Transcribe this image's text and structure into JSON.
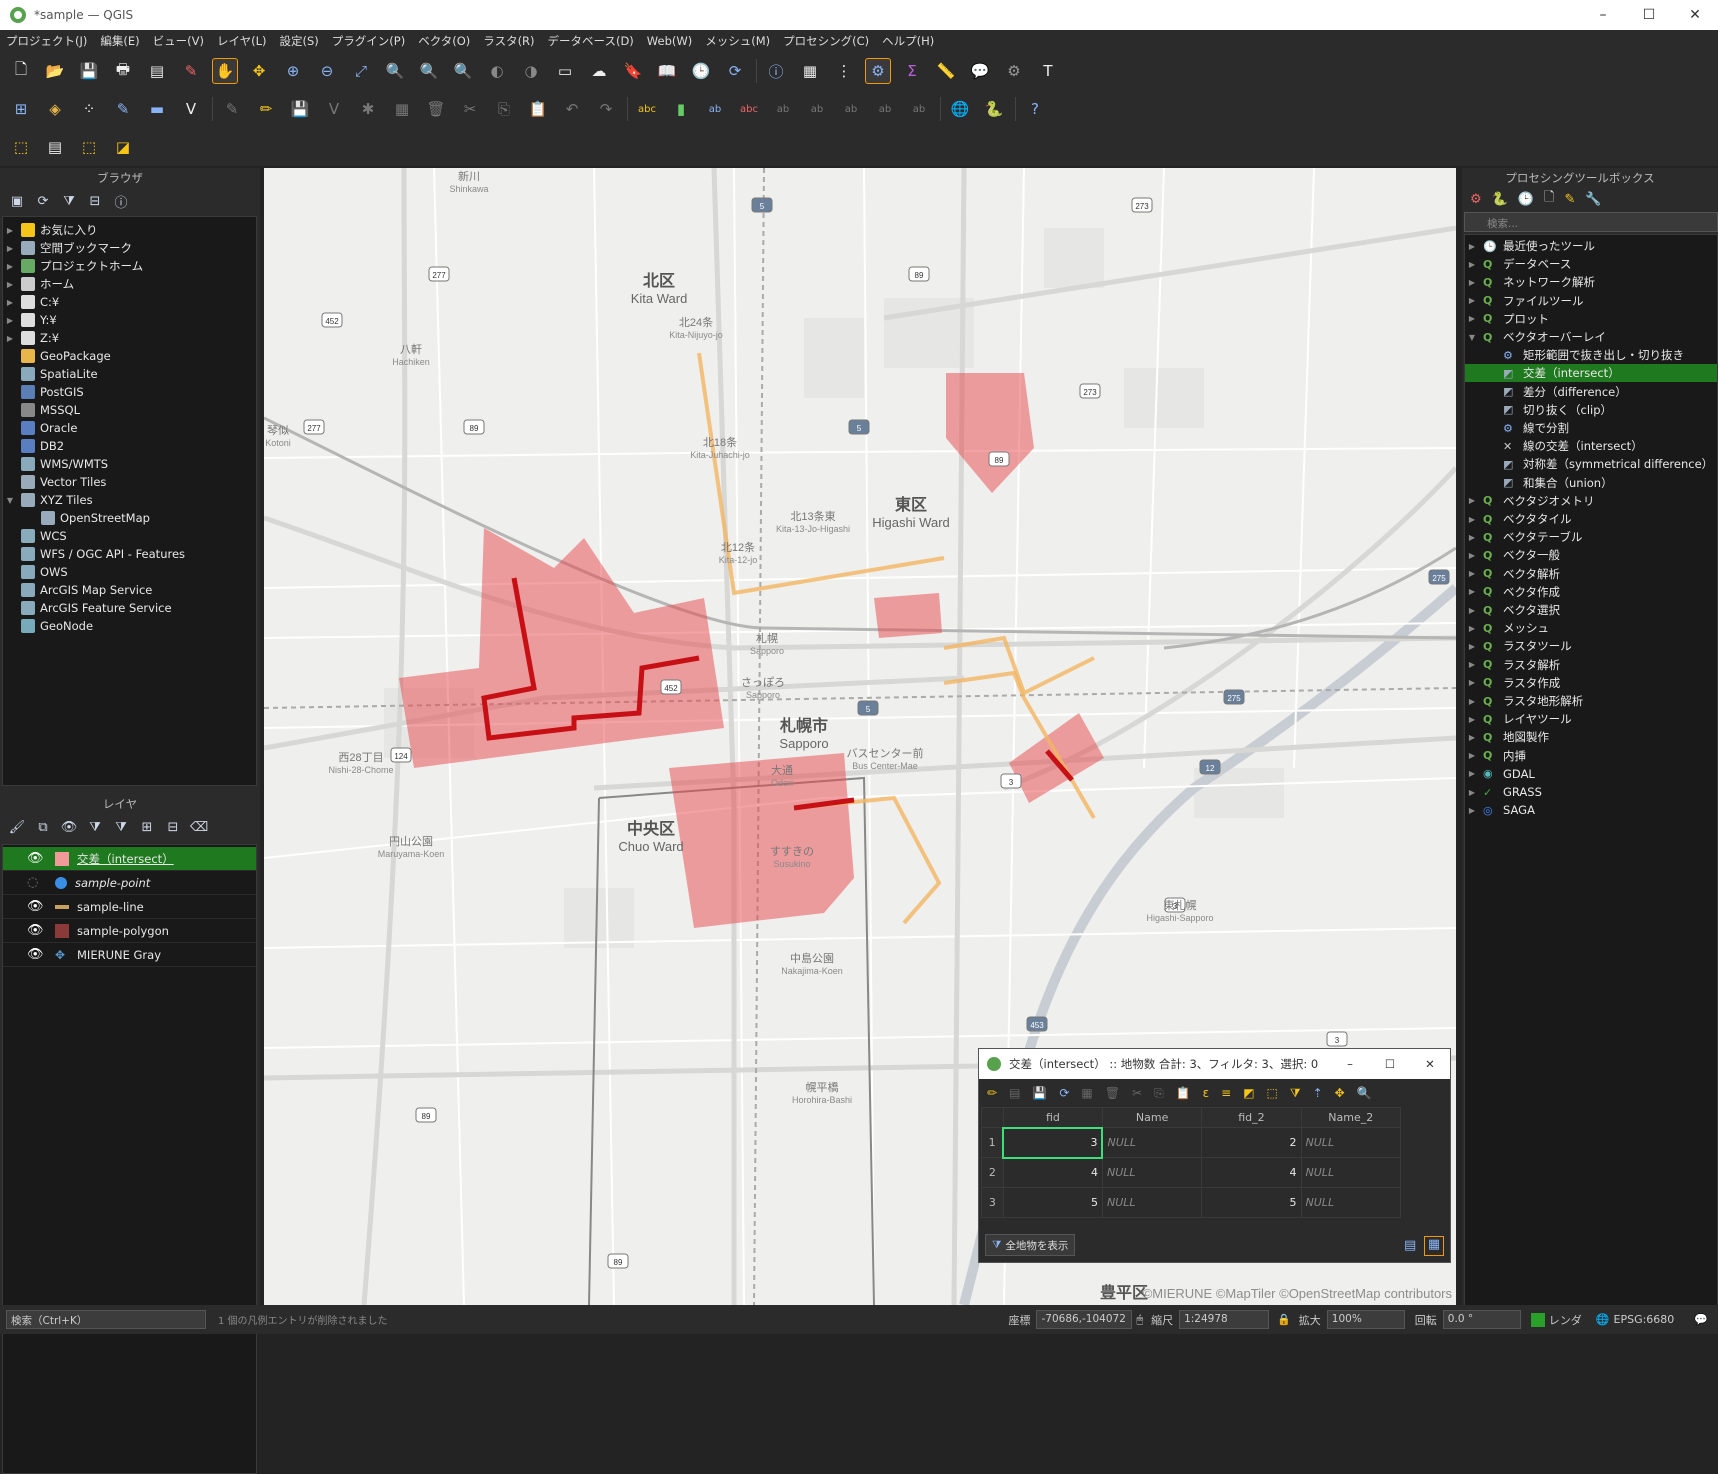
{
  "window": {
    "title": "*sample — QGIS",
    "minimize": "–",
    "maximize": "☐",
    "close": "✕"
  },
  "menu": [
    "プロジェクト(J)",
    "編集(E)",
    "ビュー(V)",
    "レイヤ(L)",
    "設定(S)",
    "プラグイン(P)",
    "ベクタ(O)",
    "ラスタ(R)",
    "データベース(D)",
    "Web(W)",
    "メッシュ(M)",
    "プロセシング(C)",
    "ヘルプ(H)"
  ],
  "browser": {
    "title": "ブラウザ",
    "items": [
      {
        "label": "お気に入り",
        "icon": "star-icon",
        "color": "#f5c518",
        "expandable": true
      },
      {
        "label": "空間ブックマーク",
        "icon": "bookmark-icon",
        "color": "#9ab",
        "expandable": true
      },
      {
        "label": "プロジェクトホーム",
        "icon": "project-home-icon",
        "color": "#6a6",
        "expandable": true
      },
      {
        "label": "ホーム",
        "icon": "home-icon",
        "color": "#ccc",
        "expandable": true
      },
      {
        "label": "C:¥",
        "icon": "folder-icon",
        "color": "#ddd",
        "expandable": true
      },
      {
        "label": "Y:¥",
        "icon": "folder-icon",
        "color": "#ddd",
        "expandable": true
      },
      {
        "label": "Z:¥",
        "icon": "folder-icon",
        "color": "#ddd",
        "expandable": true
      },
      {
        "label": "GeoPackage",
        "icon": "geopackage-icon",
        "color": "#e8b64a",
        "expandable": false
      },
      {
        "label": "SpatiaLite",
        "icon": "spatialite-icon",
        "color": "#8ab",
        "expandable": false
      },
      {
        "label": "PostGIS",
        "icon": "postgis-icon",
        "color": "#5b7fb5",
        "expandable": false
      },
      {
        "label": "MSSQL",
        "icon": "mssql-icon",
        "color": "#888",
        "expandable": false
      },
      {
        "label": "Oracle",
        "icon": "oracle-icon",
        "color": "#5a7fc0",
        "expandable": false
      },
      {
        "label": "DB2",
        "icon": "db2-icon",
        "color": "#5a7fc0",
        "expandable": false
      },
      {
        "label": "WMS/WMTS",
        "icon": "globe-icon",
        "color": "#8ab",
        "expandable": false
      },
      {
        "label": "Vector Tiles",
        "icon": "grid-icon",
        "color": "#9ab",
        "expandable": false
      },
      {
        "label": "XYZ Tiles",
        "icon": "grid-icon",
        "color": "#9ab",
        "expandable": true,
        "expanded": true
      },
      {
        "label": "OpenStreetMap",
        "icon": "grid-icon",
        "color": "#9ab",
        "expandable": false,
        "indent": true
      },
      {
        "label": "WCS",
        "icon": "globe-icon",
        "color": "#8ab",
        "expandable": false
      },
      {
        "label": "WFS / OGC API - Features",
        "icon": "globe-icon",
        "color": "#8ab",
        "expandable": false
      },
      {
        "label": "OWS",
        "icon": "globe-icon",
        "color": "#8ab",
        "expandable": false
      },
      {
        "label": "ArcGIS Map Service",
        "icon": "globe-icon",
        "color": "#8ab",
        "expandable": false
      },
      {
        "label": "ArcGIS Feature Service",
        "icon": "globe-icon",
        "color": "#8ab",
        "expandable": false
      },
      {
        "label": "GeoNode",
        "icon": "geonode-icon",
        "color": "#7ab",
        "expandable": false
      }
    ]
  },
  "layers": {
    "title": "レイヤ",
    "items": [
      {
        "label": "交差（intersect）",
        "visible": true,
        "selected": true,
        "italic": false,
        "symbol": "polygon",
        "color": "#f29999"
      },
      {
        "label": "sample-point",
        "visible": false,
        "selected": false,
        "italic": true,
        "symbol": "point",
        "color": "#3a8ee6"
      },
      {
        "label": "sample-line",
        "visible": true,
        "selected": false,
        "italic": false,
        "symbol": "line",
        "color": "#c8a060"
      },
      {
        "label": "sample-polygon",
        "visible": true,
        "selected": false,
        "italic": false,
        "symbol": "polygon",
        "color": "#8b3a3a"
      },
      {
        "label": "MIERUNE Gray",
        "visible": true,
        "selected": false,
        "italic": false,
        "symbol": "tiles",
        "color": "#5b9bd5"
      }
    ]
  },
  "processing": {
    "title": "プロセシングツールボックス",
    "search_placeholder": "検索...",
    "items": [
      {
        "label": "最近使ったツール",
        "level": 0,
        "icon": "clock-icon"
      },
      {
        "label": "データベース",
        "level": 0,
        "icon": "qgis-icon"
      },
      {
        "label": "ネットワーク解析",
        "level": 0,
        "icon": "qgis-icon"
      },
      {
        "label": "ファイルツール",
        "level": 0,
        "icon": "qgis-icon"
      },
      {
        "label": "プロット",
        "level": 0,
        "icon": "qgis-icon"
      },
      {
        "label": "ベクタオーバーレイ",
        "level": 0,
        "icon": "qgis-icon",
        "expanded": true
      },
      {
        "label": "矩形範囲で抜き出し・切り抜き",
        "level": 1,
        "icon": "gear-icon"
      },
      {
        "label": "交差（intersect）",
        "level": 1,
        "icon": "overlay-icon",
        "selected": true
      },
      {
        "label": "差分（difference）",
        "level": 1,
        "icon": "overlay-icon"
      },
      {
        "label": "切り抜く（clip）",
        "level": 1,
        "icon": "overlay-icon"
      },
      {
        "label": "線で分割",
        "level": 1,
        "icon": "gear-icon"
      },
      {
        "label": "線の交差（intersect）",
        "level": 1,
        "icon": "line-intersect-icon"
      },
      {
        "label": "対称差（symmetrical difference）",
        "level": 1,
        "icon": "overlay-icon"
      },
      {
        "label": "和集合（union）",
        "level": 1,
        "icon": "overlay-icon"
      },
      {
        "label": "ベクタジオメトリ",
        "level": 0,
        "icon": "qgis-icon"
      },
      {
        "label": "ベクタタイル",
        "level": 0,
        "icon": "qgis-icon"
      },
      {
        "label": "ベクタテーブル",
        "level": 0,
        "icon": "qgis-icon"
      },
      {
        "label": "ベクタ一般",
        "level": 0,
        "icon": "qgis-icon"
      },
      {
        "label": "ベクタ解析",
        "level": 0,
        "icon": "qgis-icon"
      },
      {
        "label": "ベクタ作成",
        "level": 0,
        "icon": "qgis-icon"
      },
      {
        "label": "ベクタ選択",
        "level": 0,
        "icon": "qgis-icon"
      },
      {
        "label": "メッシュ",
        "level": 0,
        "icon": "qgis-icon"
      },
      {
        "label": "ラスタツール",
        "level": 0,
        "icon": "qgis-icon"
      },
      {
        "label": "ラスタ解析",
        "level": 0,
        "icon": "qgis-icon"
      },
      {
        "label": "ラスタ作成",
        "level": 0,
        "icon": "qgis-icon"
      },
      {
        "label": "ラスタ地形解析",
        "level": 0,
        "icon": "qgis-icon"
      },
      {
        "label": "レイヤツール",
        "level": 0,
        "icon": "qgis-icon"
      },
      {
        "label": "地図製作",
        "level": 0,
        "icon": "qgis-icon"
      },
      {
        "label": "内挿",
        "level": 0,
        "icon": "qgis-icon"
      },
      {
        "label": "GDAL",
        "level": 0,
        "icon": "gdal-icon"
      },
      {
        "label": "GRASS",
        "level": 0,
        "icon": "grass-icon"
      },
      {
        "label": "SAGA",
        "level": 0,
        "icon": "saga-icon"
      }
    ]
  },
  "map": {
    "attribution": "©MIERUNE ©MapTiler ©OpenStreetMap contributors",
    "labels": [
      {
        "text": "北区",
        "sub": "Kita Ward",
        "big": true
      },
      {
        "text": "東区",
        "sub": "Higashi Ward",
        "big": true
      },
      {
        "text": "中央区",
        "sub": "Chuo Ward",
        "big": true
      },
      {
        "text": "札幌市",
        "sub": "Sapporo",
        "big": true
      },
      {
        "text": "豊平区",
        "sub": "",
        "big": true
      },
      {
        "text": "新川",
        "sub": "Shinkawa",
        "big": false
      },
      {
        "text": "八軒",
        "sub": "Hachiken",
        "big": false
      },
      {
        "text": "北24条",
        "sub": "Kita-Nijuyo-jo",
        "big": false
      },
      {
        "text": "北18条",
        "sub": "Kita-Juhachi-jo",
        "big": false
      },
      {
        "text": "北13条東",
        "sub": "Kita-13-Jo-Higashi",
        "big": false
      },
      {
        "text": "北12条",
        "sub": "Kita-12-jo",
        "big": false
      },
      {
        "text": "札幌",
        "sub": "Sapporo",
        "big": false
      },
      {
        "text": "さっぽろ",
        "sub": "Sapporo",
        "big": false
      },
      {
        "text": "大通",
        "sub": "Odori",
        "big": false
      },
      {
        "text": "バスセンター前",
        "sub": "Bus Center-Mae",
        "big": false
      },
      {
        "text": "西28丁目",
        "sub": "Nishi-28-Chome",
        "big": false
      },
      {
        "text": "円山公園",
        "sub": "Maruyama-Koen",
        "big": false
      },
      {
        "text": "すすきの",
        "sub": "Susukino",
        "big": false
      },
      {
        "text": "中島公園",
        "sub": "Nakajima-Koen",
        "big": false
      },
      {
        "text": "東札幌",
        "sub": "Higashi-Sapporo",
        "big": false
      },
      {
        "text": "幌平橋",
        "sub": "Horohira-Bashi",
        "big": false
      },
      {
        "text": "琴似",
        "sub": "Kotoni",
        "big": false
      }
    ],
    "route_shields": [
      "5",
      "273",
      "89",
      "277",
      "452",
      "89",
      "277",
      "5",
      "89",
      "273",
      "275",
      "452",
      "5",
      "275",
      "124",
      "3",
      "12",
      "3",
      "453",
      "3",
      "89",
      "89"
    ]
  },
  "attribute_table": {
    "title": "交差（intersect） :: 地物数 合計: 3、フィルタ: 3、選択: 0",
    "columns": [
      "fid",
      "Name",
      "fid_2",
      "Name_2"
    ],
    "rows": [
      {
        "n": "1",
        "fid": "3",
        "name": "NULL",
        "fid_2": "2",
        "name_2": "NULL"
      },
      {
        "n": "2",
        "fid": "4",
        "name": "NULL",
        "fid_2": "4",
        "name_2": "NULL"
      },
      {
        "n": "3",
        "fid": "5",
        "name": "NULL",
        "fid_2": "5",
        "name_2": "NULL"
      }
    ],
    "filter_button": "全地物を表示"
  },
  "status": {
    "search_placeholder": "検索（Ctrl+K）",
    "message": "1 個の凡例エントリが削除されました",
    "coord_label": "座標",
    "coord_value": "-70686,-104072",
    "scale_label": "縮尺",
    "scale_value": "1:24978",
    "magnifier_label": "拡大",
    "magnifier_value": "100%",
    "rotation_label": "回転",
    "rotation_value": "0.0 °",
    "render_label": "レンダ",
    "crs": "EPSG:6680"
  }
}
